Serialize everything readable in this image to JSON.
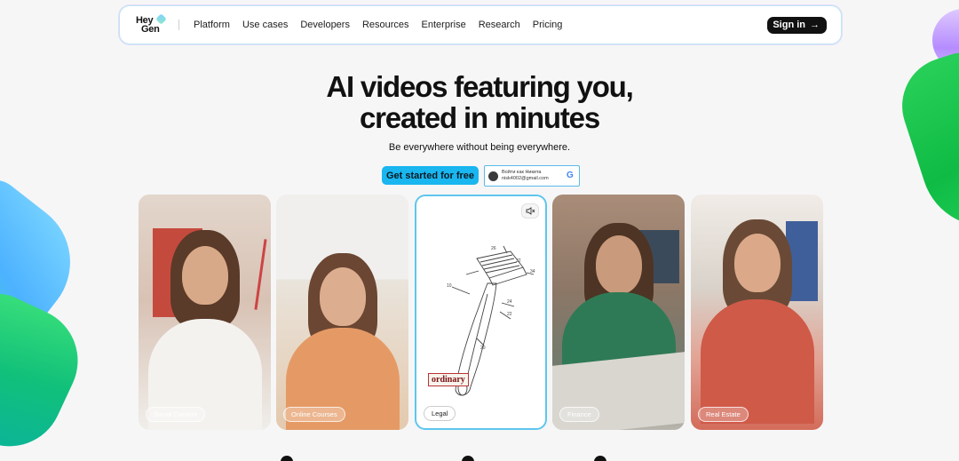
{
  "nav": {
    "logo_line1": "Hey",
    "logo_line2": "Gen",
    "links": [
      "Platform",
      "Use cases",
      "Developers",
      "Resources",
      "Enterprise",
      "Research",
      "Pricing"
    ],
    "signin_label": "Sign in",
    "signin_arrow": "→"
  },
  "hero": {
    "title_line1": "AI videos featuring you,",
    "title_line2": "created in minutes",
    "subtitle": "Be everywhere without being everywhere.",
    "cta_label": "Get started for free"
  },
  "google_signin": {
    "line1": "Войти как Никита",
    "line2": "nisk4002@gmail.com",
    "logo": "G"
  },
  "cards": [
    {
      "label": "Social Content"
    },
    {
      "label": "Online Courses"
    },
    {
      "label": "Legal",
      "overlay_word": "ordinary",
      "mute_icon": "speaker-muted-icon"
    },
    {
      "label": "Finance"
    },
    {
      "label": "Real Estate"
    }
  ],
  "colors": {
    "accent": "#19b6f0",
    "background": "#f6f6f7",
    "signin_bg": "#111111"
  }
}
